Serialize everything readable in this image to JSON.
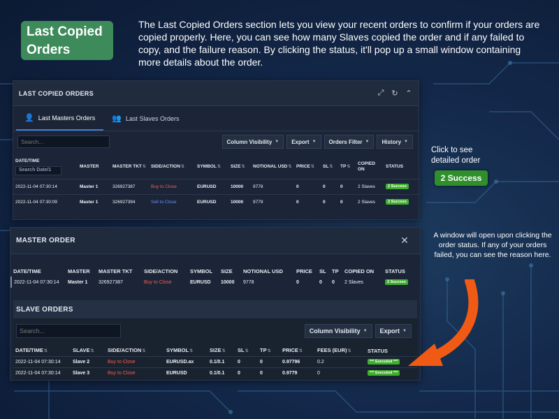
{
  "header": {
    "title": "Last Copied Orders",
    "intro": "The Last Copied Orders section lets you view your recent orders to confirm if your orders are copied properly. Here, you can see how many Slaves copied the order and if any failed to copy, and the failure reason. By clicking the status, it'll pop up a small window containing more details about the order."
  },
  "colors": {
    "badge_green": "#3d8a5a",
    "success": "#3fae2e",
    "buy_to_close": "#ff5a4a",
    "sell_to_close": "#6b8cff",
    "arrow": "#f05a14",
    "panel_bg": "#1b2537",
    "page_bg": "#13284a"
  },
  "last_copied_panel": {
    "title": "LAST COPIED ORDERS",
    "icons": [
      "expand-icon",
      "refresh-icon",
      "chevron-up-icon"
    ],
    "tabs": [
      {
        "label": "Last Masters Orders",
        "active": true
      },
      {
        "label": "Last Slaves Orders",
        "active": false
      }
    ],
    "search_placeholder": "Search...",
    "buttons": {
      "column_visibility": "Column Visibility",
      "export": "Export",
      "orders_filter": "Orders Filter",
      "history": "History"
    },
    "date_placeholder": "Search Date/1",
    "columns": [
      "DATE/TIME",
      "MASTER",
      "MASTER TKT",
      "SIDE/ACTION",
      "SYMBOL",
      "SIZE",
      "NOTIONAL USD",
      "PRICE",
      "SL",
      "TP",
      "COPIED ON",
      "STATUS"
    ],
    "rows": [
      {
        "datetime": "2022-11-04 07:30:14",
        "master": "Master 1",
        "ticket": "326927387",
        "side": "Buy to Close",
        "symbol": "EURUSD",
        "size": "10000",
        "notional": "9778",
        "price": "0",
        "sl": "0",
        "tp": "0",
        "copied_on": "2 Slaves",
        "status": "2 Success"
      },
      {
        "datetime": "2022-11-04 07:30:09",
        "master": "Master 1",
        "ticket": "326927394",
        "side": "Sell to Close",
        "symbol": "EURUSD",
        "size": "10000",
        "notional": "9779",
        "price": "0",
        "sl": "0",
        "tp": "0",
        "copied_on": "2 Slaves",
        "status": "2 Success"
      }
    ]
  },
  "callout_click": {
    "text": "Click to see detailed order",
    "badge": "2 Success"
  },
  "callout_window": {
    "text": "A window will open upon clicking the order status. If any of your orders failed, you can see the reason here."
  },
  "master_order_panel": {
    "title": "MASTER ORDER",
    "close_icon": "close-icon",
    "columns": [
      "DATE/TIME",
      "MASTER",
      "MASTER TKT",
      "SIDE/ACTION",
      "SYMBOL",
      "SIZE",
      "NOTIONAL USD",
      "PRICE",
      "SL",
      "TP",
      "COPIED ON",
      "STATUS"
    ],
    "row": {
      "datetime": "2022-11-04 07:30:14",
      "master": "Master 1",
      "ticket": "326927387",
      "side": "Buy to Close",
      "symbol": "EURUSD",
      "size": "10000",
      "notional": "9778",
      "price": "0",
      "sl": "0",
      "tp": "0",
      "copied_on": "2 Slaves",
      "status": "2 Success"
    },
    "slave_title": "SLAVE ORDERS",
    "search_placeholder": "Search...",
    "buttons": {
      "column_visibility": "Column Visibility",
      "export": "Export"
    },
    "slave_columns": [
      "DATE/TIME",
      "SLAVE",
      "SIDE/ACTION",
      "SYMBOL",
      "SIZE",
      "SL",
      "TP",
      "PRICE",
      "FEES (EUR)",
      "STATUS"
    ],
    "slave_rows": [
      {
        "datetime": "2022-11-04 07:30:14",
        "slave": "Slave 2",
        "side": "Buy to Close",
        "symbol": "EURUSD.ax",
        "size": "0.1/0.1",
        "sl": "0",
        "tp": "0",
        "price": "0.97796",
        "fees": "0.2",
        "status": "*** Executed ***"
      },
      {
        "datetime": "2022-11-04 07:30:14",
        "slave": "Slave 3",
        "side": "Buy to Close",
        "symbol": "EURUSD",
        "size": "0.1/0.1",
        "sl": "0",
        "tp": "0",
        "price": "0.9779",
        "fees": "0",
        "status": "*** Executed ***"
      }
    ]
  }
}
